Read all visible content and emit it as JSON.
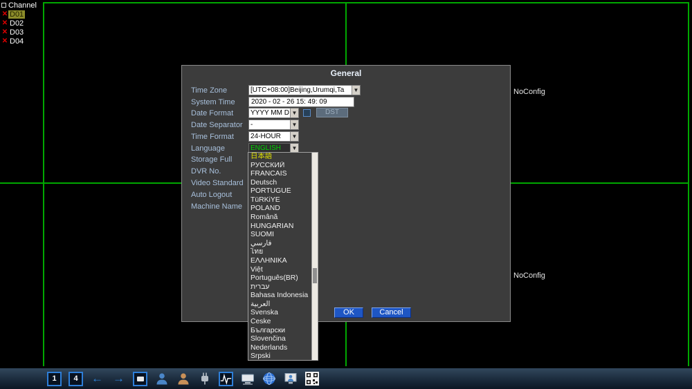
{
  "colors": {
    "grid_line_green": "#00a800",
    "dialog_bg": "#3c3c3c",
    "label_blue": "#a8c0dc",
    "language_text_green": "#00d400",
    "selected_option_yellow": "#e2e200",
    "button_blue": "#1e56c4",
    "error_red": "#e00000",
    "channel_selected_bg": "#8c8c2a"
  },
  "channel_panel": {
    "title": "Channel",
    "channels": [
      {
        "label": "D01",
        "selected": true
      },
      {
        "label": "D02",
        "selected": false
      },
      {
        "label": "D03",
        "selected": false
      },
      {
        "label": "D04",
        "selected": false
      }
    ]
  },
  "video_grid": {
    "no_config_labels": [
      "NoConfig",
      "NoConfig"
    ]
  },
  "dialog": {
    "title": "General",
    "fields": {
      "time_zone": {
        "label": "Time Zone",
        "value": "[UTC+08:00]Beijing,Urumqi,Ta"
      },
      "system_time": {
        "label": "System Time",
        "value": "2020 - 02 - 26  15: 49: 09"
      },
      "date_format": {
        "label": "Date Format",
        "value": "YYYY MM D",
        "dst_button": "DST"
      },
      "date_separator": {
        "label": "Date Separator",
        "value": "-"
      },
      "time_format": {
        "label": "Time Format",
        "value": "24-HOUR"
      },
      "language": {
        "label": "Language",
        "value": "ENGLISH"
      },
      "storage_full": {
        "label": "Storage Full"
      },
      "dvr_no": {
        "label": "DVR No."
      },
      "video_standard": {
        "label": "Video Standard"
      },
      "auto_logout": {
        "label": "Auto Logout"
      },
      "machine_name": {
        "label": "Machine Name"
      }
    },
    "buttons": {
      "ok": "OK",
      "cancel": "Cancel"
    }
  },
  "language_dropdown": {
    "options": [
      "日本語",
      "РУССКИЙ",
      "FRANCAIS",
      "Deutsch",
      "PORTUGUÊ",
      "TüRKiYE",
      "POLAND",
      "Română",
      "HUNGARIAN",
      "SUOMI",
      "فارسي",
      "ไทย",
      "ΕΛΛΗΝΙΚΑ",
      "Việt",
      "Português(BR)",
      "עברית",
      "Bahasa Indonesia",
      "العربية",
      "Svenska",
      "Česke",
      "Български",
      "Slovenčina",
      "Nederlands",
      "Srpski"
    ],
    "selected_index": 0
  },
  "toolbar": {
    "view1_label": "1",
    "view4_label": "4",
    "prev_glyph": "←",
    "next_glyph": "→"
  }
}
